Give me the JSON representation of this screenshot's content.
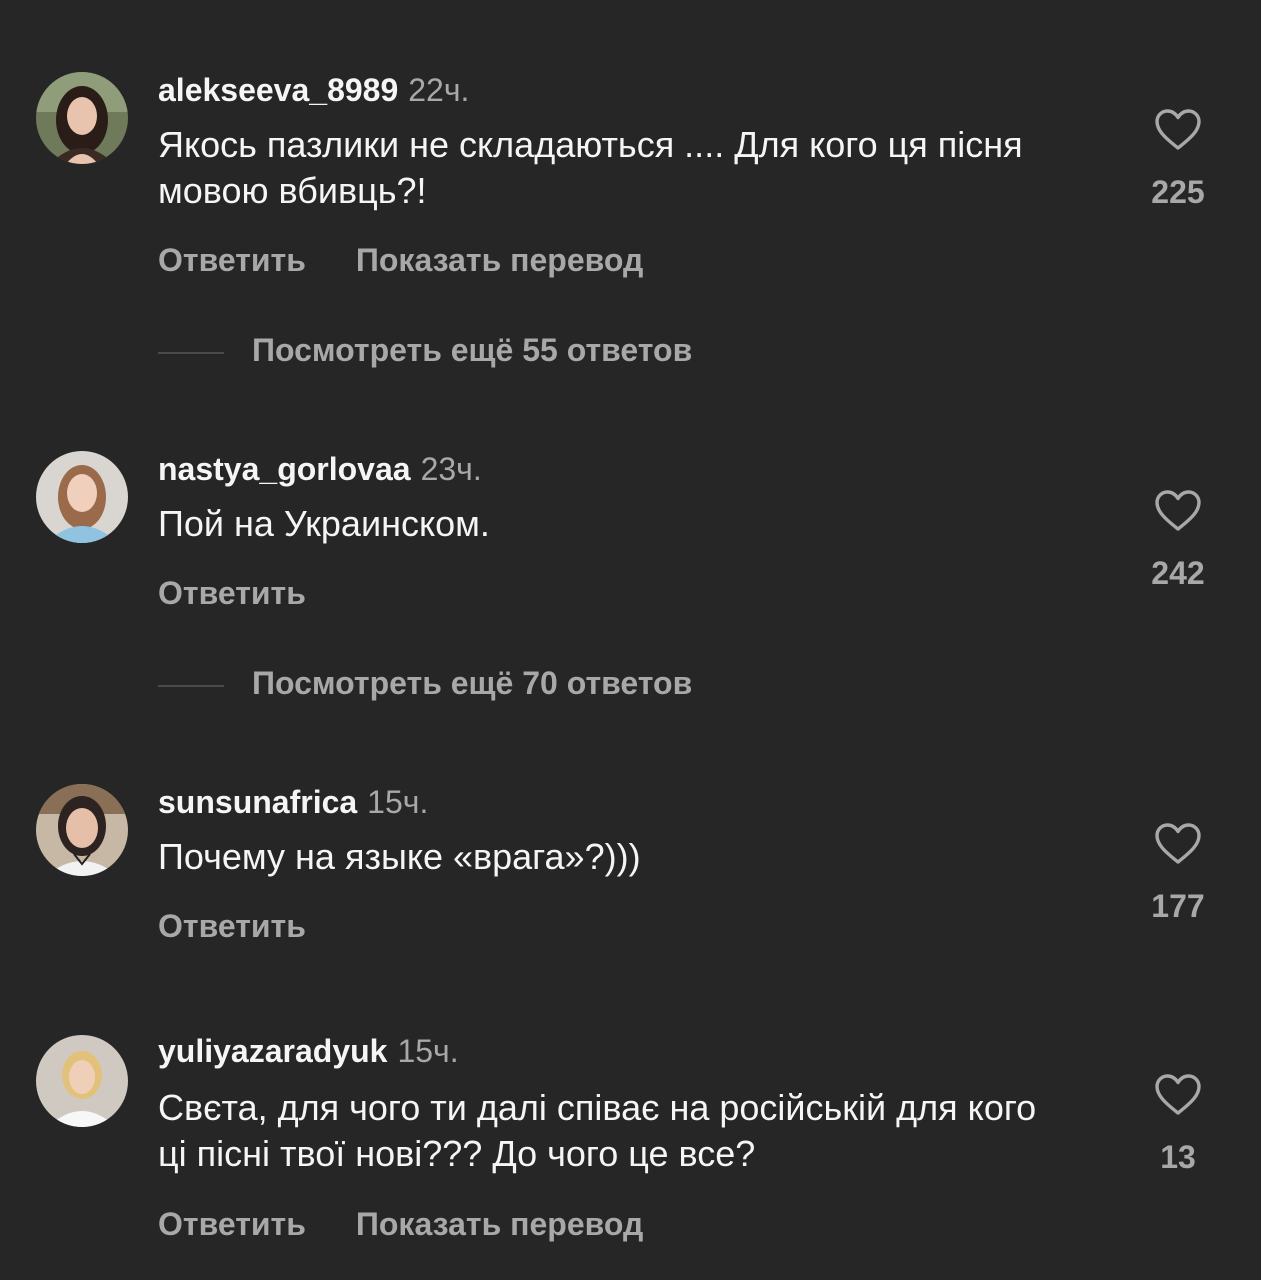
{
  "comments": [
    {
      "username": "alekseeva_8989",
      "time": "22ч.",
      "text": "Якось пазлики не складаються .... Для кого ця пісня мовою вбивць?!",
      "reply_label": "Ответить",
      "translate_label": "Показать перевод",
      "likes": "225",
      "view_replies": "Посмотреть ещё 55 ответов"
    },
    {
      "username": "nastya_gorlovaa",
      "time": "23ч.",
      "text": "Пой на Украинском.",
      "reply_label": "Ответить",
      "likes": "242",
      "view_replies": "Посмотреть ещё 70 ответов"
    },
    {
      "username": "sunsunafrica",
      "time": "15ч.",
      "text": "Почему на языке «врага»?)))",
      "reply_label": "Ответить",
      "likes": "177"
    },
    {
      "username": "yuliyazaradyuk",
      "time": "15ч.",
      "text": "Свєта, для чого ти далі співає на російській для кого ці пісні твої нові??? До чого це все?",
      "reply_label": "Ответить",
      "translate_label": "Показать перевод",
      "likes": "13"
    }
  ],
  "icons": {
    "like": "heart-outline-icon"
  },
  "colors": {
    "background": "#262626",
    "primary_text": "#f5f5f5",
    "secondary_text": "#a8a8a8"
  }
}
